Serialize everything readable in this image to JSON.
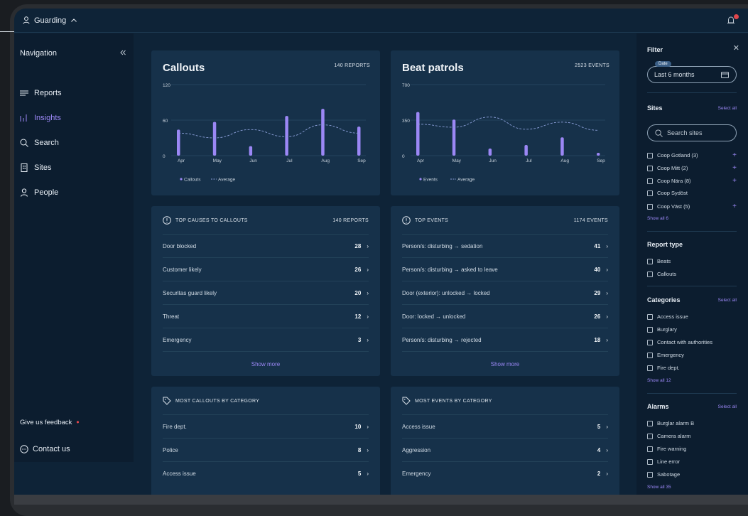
{
  "topbar": {
    "tenant": "Guarding",
    "tenant_icon": "person-icon",
    "chevron_icon": "chevron-up-icon",
    "bell_icon": "bell-icon"
  },
  "sidebar": {
    "title": "Navigation",
    "collapse_icon": "double-chevron-left-icon",
    "items": [
      {
        "label": "Reports",
        "icon": "lines-icon",
        "active": false
      },
      {
        "label": "Insights",
        "icon": "bars-icon",
        "active": true
      },
      {
        "label": "Search",
        "icon": "search-icon",
        "active": false
      },
      {
        "label": "Sites",
        "icon": "building-icon",
        "active": false
      },
      {
        "label": "People",
        "icon": "person-icon",
        "active": false
      }
    ],
    "feedback": "Give us feedback",
    "contact": "Contact us"
  },
  "charts": {
    "callouts": {
      "title": "Callouts",
      "count": "140 REPORTS",
      "legend_main": "Callouts",
      "legend_avg": "Average"
    },
    "patrols": {
      "title": "Beat patrols",
      "count": "2523 EVENTS",
      "legend_main": "Events",
      "legend_avg": "Average"
    }
  },
  "chart_data": [
    {
      "type": "bar",
      "title": "Callouts",
      "categories": [
        "Apr",
        "May",
        "Jun",
        "Jul",
        "Aug",
        "Sep"
      ],
      "yticks": [
        "0",
        "60",
        "120"
      ],
      "ylim": [
        0,
        120
      ],
      "series": [
        {
          "name": "Callouts",
          "values": [
            44,
            57,
            16,
            67,
            79,
            49
          ]
        },
        {
          "name": "Average",
          "values": [
            38,
            30,
            44,
            32,
            52,
            38
          ]
        }
      ]
    },
    {
      "type": "bar",
      "title": "Beat patrols",
      "categories": [
        "Apr",
        "May",
        "Jun",
        "Jul",
        "Aug",
        "Sep"
      ],
      "yticks": [
        "0",
        "350",
        "700"
      ],
      "ylim": [
        0,
        700
      ],
      "series": [
        {
          "name": "Events",
          "values": [
            430,
            355,
            70,
            105,
            180,
            28
          ]
        },
        {
          "name": "Average",
          "values": [
            310,
            280,
            380,
            260,
            330,
            250
          ]
        }
      ]
    }
  ],
  "top_causes": {
    "title": "TOP CAUSES TO CALLOUTS",
    "count": "140 REPORTS",
    "show_more": "Show more",
    "rows": [
      {
        "label": "Door blocked",
        "value": "28"
      },
      {
        "label": "Customer likely",
        "value": "26"
      },
      {
        "label": "Securitas guard likely",
        "value": "20"
      },
      {
        "label": "Threat",
        "value": "12"
      },
      {
        "label": "Emergency",
        "value": "3"
      }
    ]
  },
  "top_events": {
    "title": "TOP EVENTS",
    "count": "1174 EVENTS",
    "show_more": "Show more",
    "rows": [
      {
        "label": "Person/s: disturbing → sedation",
        "value": "41"
      },
      {
        "label": "Person/s: disturbing → asked to leave",
        "value": "40"
      },
      {
        "label": "Door (exterior): unlocked → locked",
        "value": "29"
      },
      {
        "label": "Door: locked → unlocked",
        "value": "26"
      },
      {
        "label": "Person/s: disturbing → rejected",
        "value": "18"
      }
    ]
  },
  "callouts_by_category": {
    "title": "MOST CALLOUTS BY CATEGORY",
    "rows": [
      {
        "label": "Fire dept.",
        "value": "10"
      },
      {
        "label": "Police",
        "value": "8"
      },
      {
        "label": "Access issue",
        "value": "5"
      }
    ]
  },
  "events_by_category": {
    "title": "MOST EVENTS BY CATEGORY",
    "rows": [
      {
        "label": "Access issue",
        "value": "5"
      },
      {
        "label": "Aggression",
        "value": "4"
      },
      {
        "label": "Emergency",
        "value": "2"
      }
    ]
  },
  "filter": {
    "title": "Filter",
    "date_tag": "Date",
    "date_value": "Last 6 months",
    "sites_title": "Sites",
    "select_all": "Select all",
    "search_placeholder": "Search sites",
    "sites": [
      "Coop Gotland (3)",
      "Coop Mitt (2)",
      "Coop Nära (8)",
      "Coop Sydöst",
      "Coop Väst (5)"
    ],
    "sites_show_all": "Show all 6",
    "report_type_title": "Report type",
    "report_types": [
      "Beats",
      "Callouts"
    ],
    "categories_title": "Categories",
    "categories": [
      "Access issue",
      "Burglary",
      "Contact with authorities",
      "Emergency",
      "Fire dept."
    ],
    "categories_show_all": "Show all 12",
    "alarms_title": "Alarms",
    "alarms": [
      "Burglar alarm B",
      "Camera alarm",
      "Fire warning",
      "Line error",
      "Sabotage"
    ],
    "alarms_show_all": "Show all 35"
  },
  "colors": {
    "accent": "#9b87f5",
    "bg": "#0e2337",
    "card": "#16314a",
    "alert": "#e0474c"
  }
}
